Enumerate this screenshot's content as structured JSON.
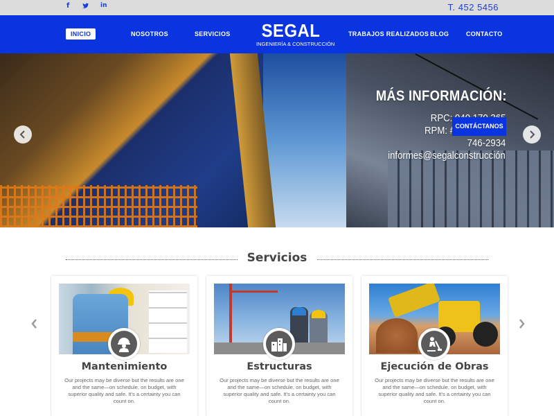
{
  "topbar": {
    "social": [
      {
        "name": "facebook-icon",
        "glyph": "f"
      },
      {
        "name": "twitter-icon",
        "glyph": "⚑"
      },
      {
        "name": "linkedin-icon",
        "glyph": "in"
      }
    ],
    "phone": "T. 452 5456"
  },
  "nav": {
    "items": [
      {
        "label": "INICIO",
        "active": true
      },
      {
        "label": "NOSOTROS"
      },
      {
        "label": "SERVICIOS"
      },
      {
        "label": "TRABAJOS REALIZADOS"
      },
      {
        "label": "BLOG"
      },
      {
        "label": "CONTACTO"
      }
    ],
    "logo_title": "SEGAL",
    "logo_subtitle": "INGENIERÍA & CONSTRUCCIÓN"
  },
  "hero": {
    "title": "MÁS INFORMACIÓN:",
    "lines": [
      "RPC: 940 170 365",
      "RPM: #942 016 105",
      "746-2934",
      "informes@segalconstrucción"
    ],
    "button_label": "CONTÁCTANOS"
  },
  "services": {
    "title": "Servicios",
    "cards": [
      {
        "title": "Mantenimiento",
        "icon": "worker-helmet-icon",
        "description": "Our projects may be diverse but the results are one and the same—on schedule, on budget, with superior quality and safe. It's a certainty you can count on."
      },
      {
        "title": "Estructuras",
        "icon": "buildings-icon",
        "description": "Our projects may be diverse but the results are one and the same—on schedule, on budget, with superior quality and safe. It's a certainty you can count on."
      },
      {
        "title": "Ejecución de Obras",
        "icon": "worker-digging-icon",
        "description": "Our projects may be diverse but the results are one and the same—on schedule, on budget, with superior quality and safe. It's a certainty you can count on."
      }
    ]
  },
  "colors": {
    "brand_blue": "#0a34e0",
    "topbar_bg": "#dcdcdc"
  }
}
